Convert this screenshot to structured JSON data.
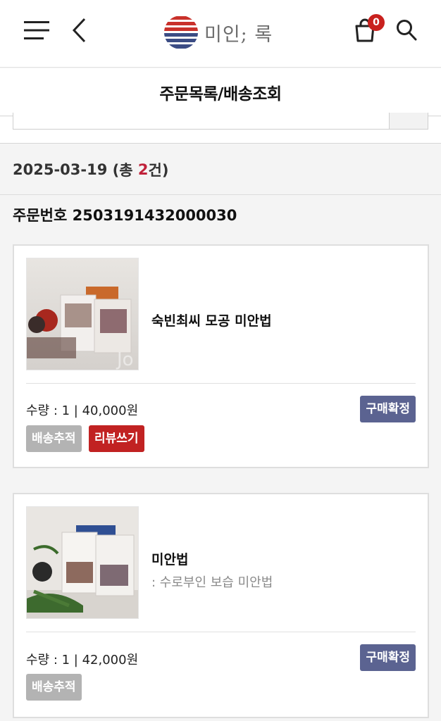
{
  "header": {
    "logo_text": "미인; 록",
    "cart_count": "0",
    "icons": [
      "menu-icon",
      "back-arrow-icon",
      "cart-icon",
      "search-icon"
    ],
    "brand_colors": {
      "logo_red": "#c9312b",
      "logo_navy": "#3b4c84"
    }
  },
  "page": {
    "title": "주문목록/배송조회"
  },
  "order_group": {
    "date": "2025-03-19",
    "count_prefix": " (총 ",
    "count": "2",
    "count_suffix": "건)",
    "count_color": "#c0223b"
  },
  "order": {
    "number_label": "주문번호",
    "number": "2503191432000030",
    "items": [
      {
        "name": "숙빈최씨 모공 미안법",
        "option": "",
        "quantity_text": "수량 : 1 | 40,000원",
        "status_label": "구매확정",
        "track_label": "배송추적",
        "review_label": "리뷰쓰기"
      },
      {
        "name": "미안법",
        "option": ": 수로부인 보습 미안법",
        "quantity_text": "수량 : 1 | 42,000원",
        "status_label": "구매확정",
        "track_label": "배송추적"
      }
    ]
  }
}
